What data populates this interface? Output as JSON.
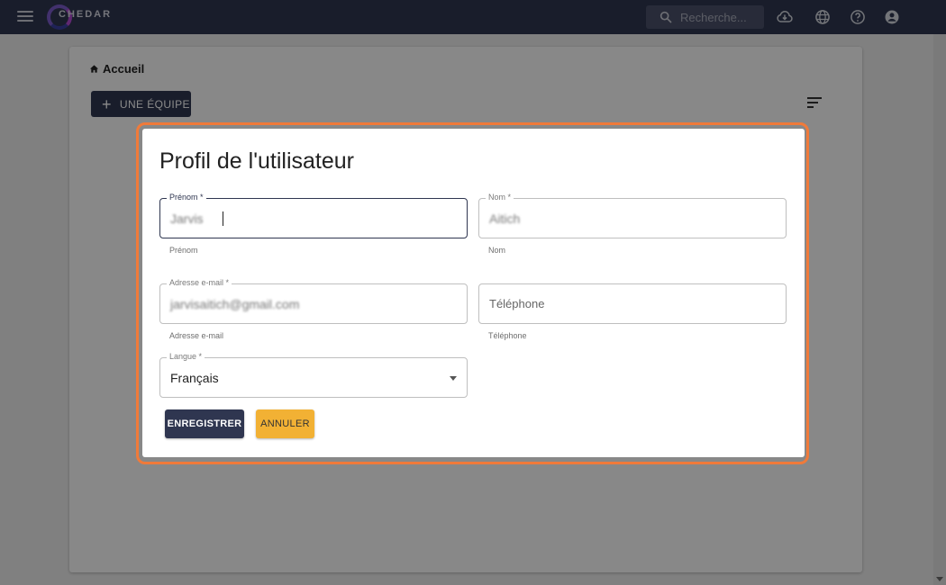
{
  "header": {
    "logo_text": "CHEDAR",
    "search_placeholder": "Recherche..."
  },
  "breadcrumb": {
    "home_label": "Accueil"
  },
  "toolbar": {
    "add_team_label": "UNE ÉQUIPE"
  },
  "dialog": {
    "title": "Profil de l'utilisateur",
    "fields": {
      "first_name": {
        "label": "Prénom *",
        "value": "Jarvis",
        "helper": "Prénom"
      },
      "last_name": {
        "label": "Nom *",
        "value": "Aitich",
        "helper": "Nom"
      },
      "email": {
        "label": "Adresse e-mail *",
        "value": "jarvisaitich@gmail.com",
        "helper": "Adresse e-mail"
      },
      "phone": {
        "placeholder": "Téléphone",
        "helper": "Téléphone"
      },
      "language": {
        "label": "Langue *",
        "value": "Français"
      }
    },
    "save_label": "ENREGISTRER",
    "cancel_label": "ANNULER"
  },
  "colors": {
    "primary": "#2f3650",
    "accent_cancel": "#f2b134",
    "highlight_frame": "#f07a3a"
  }
}
